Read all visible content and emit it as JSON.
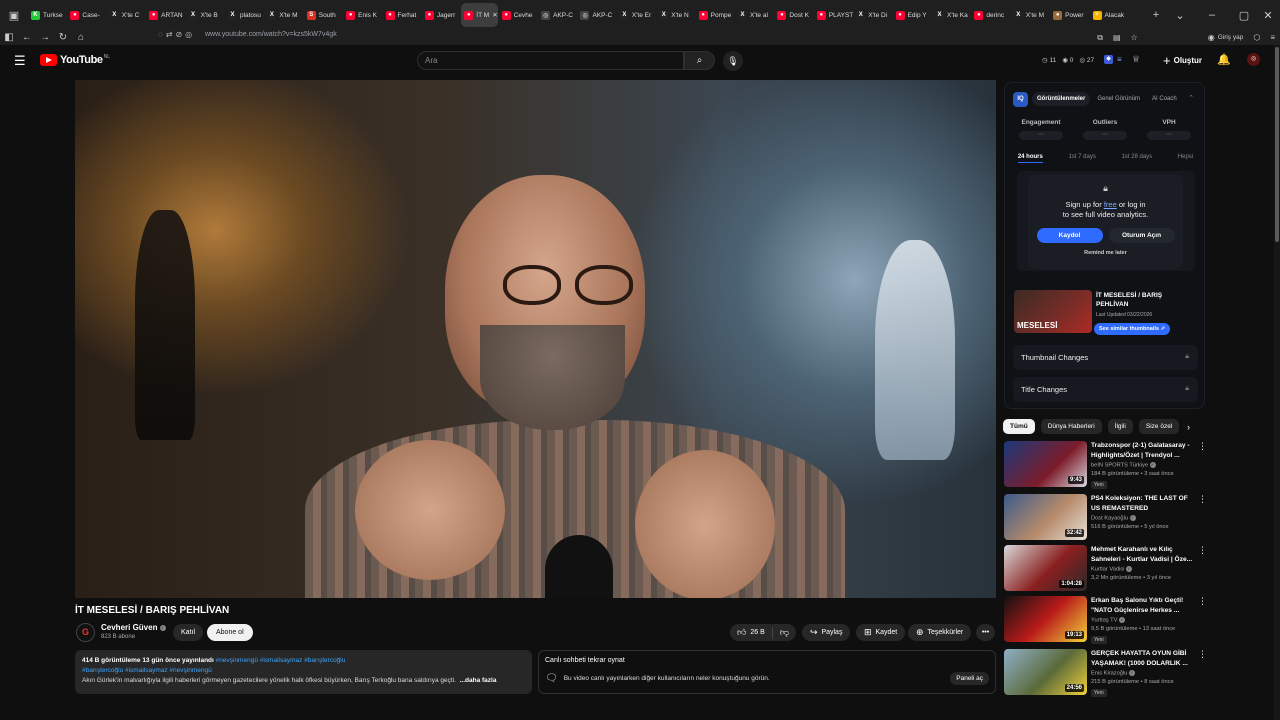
{
  "browser": {
    "tabs": [
      {
        "label": "Turkse",
        "fav": "K",
        "color": "#25c83c"
      },
      {
        "label": "Case-",
        "fav": "●",
        "color": "#ff0033"
      },
      {
        "label": "X'te C",
        "fav": "X",
        "color": "#222222"
      },
      {
        "label": "ARTAN",
        "fav": "●",
        "color": "#ff0033"
      },
      {
        "label": "X'te B",
        "fav": "X",
        "color": "#222222"
      },
      {
        "label": "platosu",
        "fav": "X",
        "color": "#222222"
      },
      {
        "label": "X'te M",
        "fav": "X",
        "color": "#222222"
      },
      {
        "label": "South",
        "fav": "S",
        "color": "#d93025"
      },
      {
        "label": "Enis K",
        "fav": "●",
        "color": "#ff0033"
      },
      {
        "label": "Ferhat",
        "fav": "●",
        "color": "#ff0033"
      },
      {
        "label": "Jagerr",
        "fav": "●",
        "color": "#ff0033"
      },
      {
        "label": "İT M",
        "fav": "●",
        "color": "#ff0033",
        "active": true
      },
      {
        "label": "Cevhe",
        "fav": "●",
        "color": "#ff0033"
      },
      {
        "label": "AKP-C",
        "fav": "◎",
        "color": "#444444"
      },
      {
        "label": "AKP-C",
        "fav": "◎",
        "color": "#444444"
      },
      {
        "label": "X'te Er",
        "fav": "X",
        "color": "#222222"
      },
      {
        "label": "X'te N",
        "fav": "X",
        "color": "#222222"
      },
      {
        "label": "Pompe",
        "fav": "●",
        "color": "#ff0033"
      },
      {
        "label": "X'te al",
        "fav": "X",
        "color": "#222222"
      },
      {
        "label": "Dost K",
        "fav": "●",
        "color": "#ff0033"
      },
      {
        "label": "PLAYST",
        "fav": "●",
        "color": "#ff0033"
      },
      {
        "label": "X'te Di",
        "fav": "X",
        "color": "#222222"
      },
      {
        "label": "Edip Y",
        "fav": "●",
        "color": "#ff0033"
      },
      {
        "label": "X'te Ka",
        "fav": "X",
        "color": "#222222"
      },
      {
        "label": "derinc",
        "fav": "●",
        "color": "#ff0033"
      },
      {
        "label": "X'te M",
        "fav": "X",
        "color": "#222222"
      },
      {
        "label": "Power",
        "fav": "●",
        "color": "#9a6b3a"
      },
      {
        "label": "Alacak",
        "fav": "+",
        "color": "#f4b400"
      }
    ],
    "url": "www.youtube.com/watch?v=kzs5kW7v4gk",
    "signin": "Giriş yap"
  },
  "header": {
    "logo": "YouTube",
    "logo_suffix": "NL",
    "search_placeholder": "Ara",
    "stat_a": "11",
    "stat_b": "0",
    "stat_c": "27",
    "create_label": "Oluştur"
  },
  "video": {
    "title": "İT MESELESİ / BARIŞ PEHLİVAN",
    "channel": "Cevheri Güven",
    "subscribers": "823 B abone",
    "join_label": "Katıl",
    "subscribe_label": "Abone ol",
    "likes": "26 B",
    "share_label": "Paylaş",
    "save_label": "Kaydet",
    "thanks_label": "Teşekkürler"
  },
  "description": {
    "meta": "414 B görüntüleme  13 gün önce yayınlandı",
    "tags_line1": "#nevşinmengü #ismailsaymaz #barıştercoğlu",
    "tags_line2": "#barıştercoğlu #ismailsaymaz #nevşinmengü",
    "body": "Akın Gürlek'in malvarlığıyla ilgili haberleri görmeyen gazetecilere yönelik halk öfkesi büyürken, Barış Terkoğlu bana saldırıya geçti.",
    "more": "...daha fazla"
  },
  "chat": {
    "title": "Canlı sohbeti tekrar oynat",
    "info": "Bu video canlı yayınlarken diğer kullanıcıların neler konuştuğunu görün.",
    "open_label": "Paneli aç"
  },
  "extension": {
    "logo": "IQ",
    "tabs": [
      "Görüntülenmeler",
      "Genel Görünüm",
      "AI Coach"
    ],
    "metrics": [
      {
        "label": "Engagement",
        "value": "---"
      },
      {
        "label": "Outliers",
        "value": "---"
      },
      {
        "label": "VPH",
        "value": "---"
      }
    ],
    "ranges": [
      "24 hours",
      "1st 7 days",
      "1st 28 days",
      "Hepsi"
    ],
    "overlay_line1_prefix": "Sign up for ",
    "overlay_free": "free",
    "overlay_line1_suffix": " or log in",
    "overlay_line2": "to see full video analytics.",
    "signup_label": "Kaydol",
    "login_label": "Oturum Açın",
    "later_label": "Remind me later",
    "thumb_text": "MESELESİ",
    "video_title": "İT MESELESİ / BARIŞ PEHLİVAN",
    "last_updated": "Last Updated 03/22/2026",
    "similar_label": "See similar thumbnails",
    "thumbnail_changes": "Thumbnail Changes",
    "title_changes": "Title Changes"
  },
  "chips": [
    "Tümü",
    "Dünya Haberleri",
    "İlgili",
    "Size özel"
  ],
  "recommendations": [
    {
      "title": "Trabzonspor (2-1) Galatasaray - Highlights/Özet | Trendyol ...",
      "channel": "beIN SPORTS Türkiye",
      "views": "184 B görüntüleme • 3 saat önce",
      "duration": "9:43",
      "badge": "Yeni",
      "bg": "linear-gradient(135deg,#1b3a7a,#7d1c2a 60%,#d8d8e0)"
    },
    {
      "title": "PS4 Koleksiyon:  THE LAST OF US REMASTERED",
      "channel": "Dost Kayaoğlu",
      "views": "516 B görüntüleme • 5 yıl önce",
      "duration": "32:42",
      "badge": "",
      "bg": "linear-gradient(135deg,#3b5b8a,#b58a6a 55%,#e8e2d8)"
    },
    {
      "title": "Mehmet Karahanlı ve Kılıç Sahneleri - Kurtlar Vadisi | Öze...",
      "channel": "Kurtlar Vadisi",
      "views": "3,2 Mn görüntüleme • 3 yıl önce",
      "duration": "1:04:28",
      "badge": "",
      "bg": "linear-gradient(135deg,#d9d9d9,#8a1f1f 55%,#2a2a2a)"
    },
    {
      "title": "Erkan Baş Salonu Yıktı Geçti! \"NATO Güçlenirse Herkes ...",
      "channel": "Yurttaş TV",
      "views": "9,5 B görüntüleme • 13 saat önce",
      "duration": "19:13",
      "badge": "Yeni",
      "bg": "linear-gradient(135deg,#111,#b81a1a 50%,#f2d33a)"
    },
    {
      "title": "GERÇEK HAYATTA OYUN GİBİ YAŞAMAK! (1000 DOLARLIK ...",
      "channel": "Enis Kirazoğlu",
      "views": "215 B görüntüleme • 8 saat önce",
      "duration": "24:56",
      "badge": "Yeni",
      "bg": "linear-gradient(135deg,#8fb0c8,#5b6a3a 55%,#f0d23a)"
    }
  ]
}
